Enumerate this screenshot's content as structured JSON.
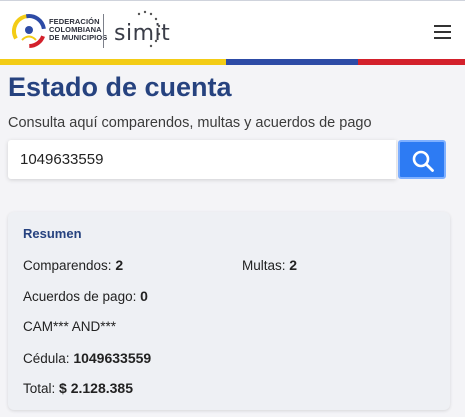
{
  "header": {
    "fcm_logo_lines": [
      "FEDERACIÓN",
      "COLOMBIANA",
      "DE MUNICIPIOS"
    ],
    "simit_logo": "simit",
    "menu_icon": "hamburger-icon",
    "stripe_colors": [
      "#f3cc16",
      "#2d4ba6",
      "#d3202b"
    ]
  },
  "page": {
    "title": "Estado de cuenta",
    "subtitle": "Consulta aquí comparendos, multas y acuerdos de pago"
  },
  "search": {
    "value": "1049633559",
    "button_icon": "search-icon",
    "button_color": "#2d7bf3"
  },
  "summary": {
    "title": "Resumen",
    "comparendos_label": "Comparendos:",
    "comparendos_value": "2",
    "multas_label": "Multas:",
    "multas_value": "2",
    "acuerdos_label": "Acuerdos de pago:",
    "acuerdos_value": "0",
    "name": "CAM*** AND***",
    "cedula_label": "Cédula:",
    "cedula_value": "1049633559",
    "total_label": "Total:",
    "total_value": "$ 2.128.385"
  }
}
